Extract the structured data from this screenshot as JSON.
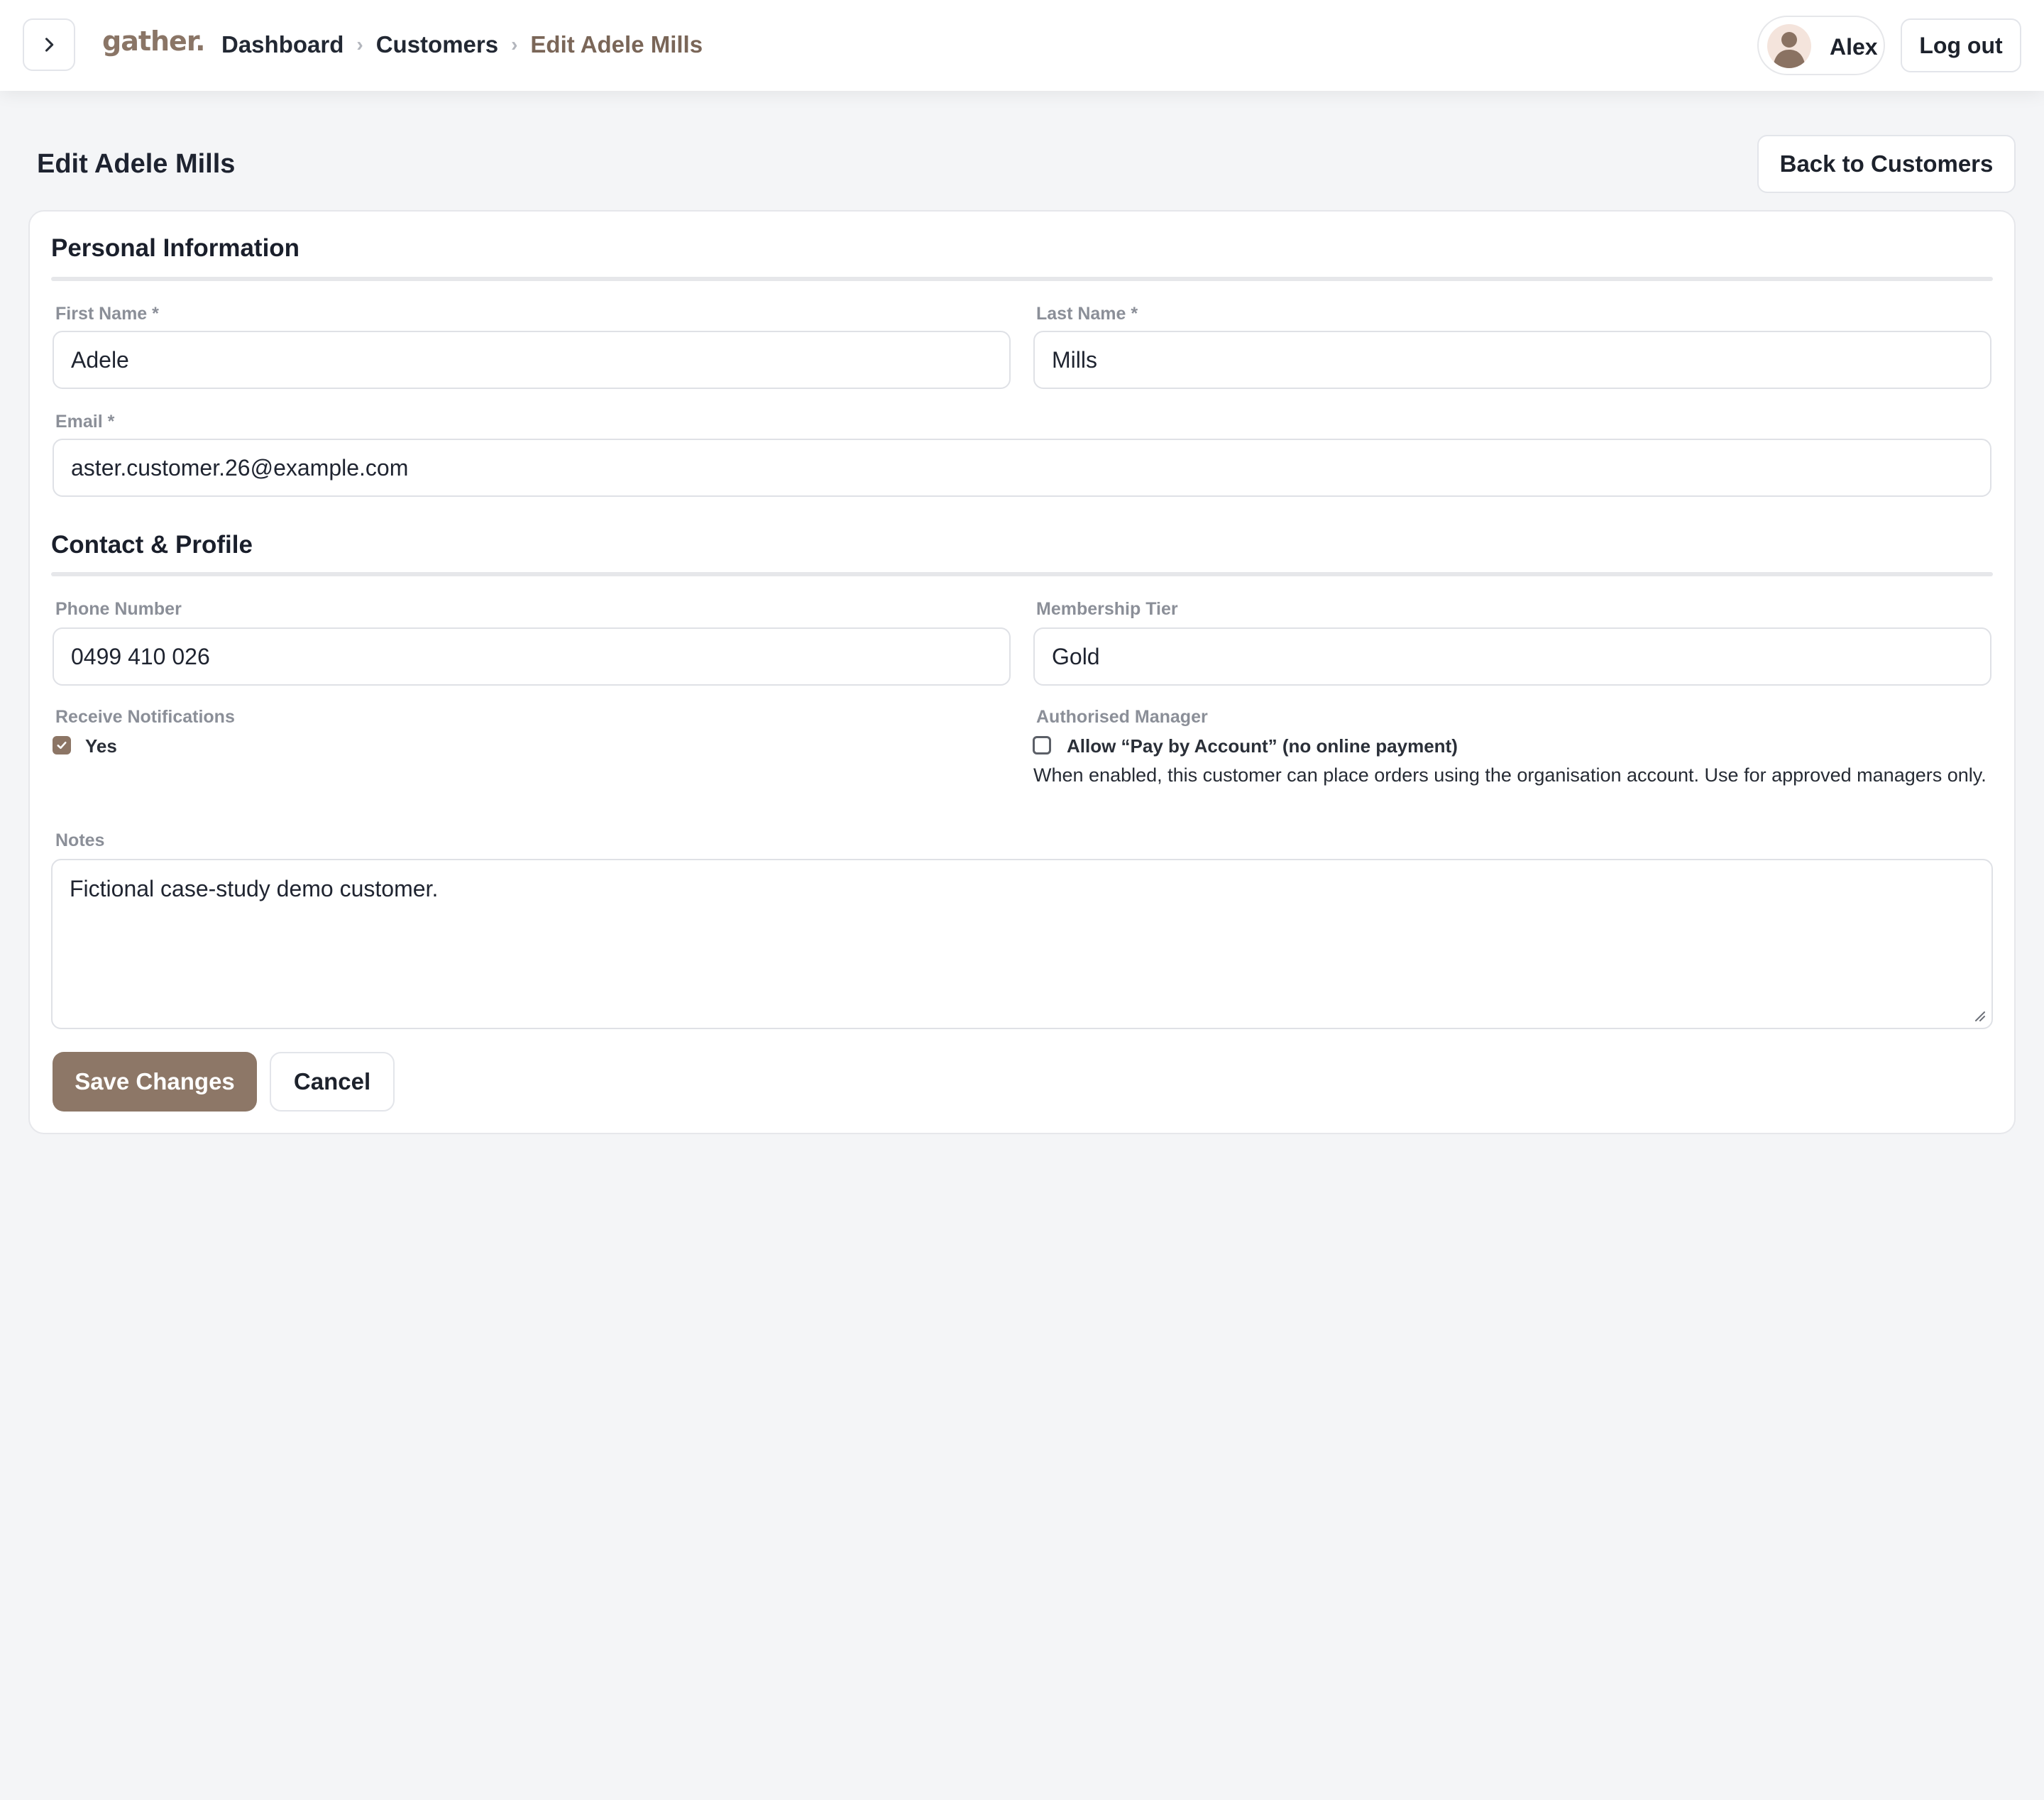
{
  "brand": {
    "logo": "gather.",
    "accent": "#8d7767"
  },
  "breadcrumb": {
    "items": [
      "Dashboard",
      "Customers"
    ],
    "current": "Edit Adele Mills",
    "separator": "›"
  },
  "user": {
    "name": "Alex",
    "logout_label": "Log out"
  },
  "page": {
    "title": "Edit Adele Mills",
    "back_label": "Back to Customers"
  },
  "sections": {
    "personal": "Personal Information",
    "contact": "Contact & Profile"
  },
  "fields": {
    "first_name": {
      "label": "First Name *",
      "value": "Adele"
    },
    "last_name": {
      "label": "Last Name *",
      "value": "Mills"
    },
    "email": {
      "label": "Email *",
      "value": "aster.customer.26@example.com"
    },
    "phone": {
      "label": "Phone Number",
      "value": "0499 410 026"
    },
    "tier": {
      "label": "Membership Tier",
      "value": "Gold"
    },
    "notifications": {
      "label": "Receive Notifications",
      "option": "Yes",
      "checked": true
    },
    "manager": {
      "label": "Authorised Manager",
      "option": "Allow “Pay by Account” (no online payment)",
      "checked": false,
      "help": "When enabled, this customer can place orders using the organisation account. Use for approved managers only."
    },
    "notes": {
      "label": "Notes",
      "value": "Fictional case-study demo customer."
    }
  },
  "actions": {
    "save": "Save Changes",
    "cancel": "Cancel"
  },
  "icons": {
    "sidebar_toggle": "chevron-right-icon",
    "avatar": "user-avatar-icon",
    "checkmark": "check-icon",
    "resize": "resize-grip-icon"
  }
}
